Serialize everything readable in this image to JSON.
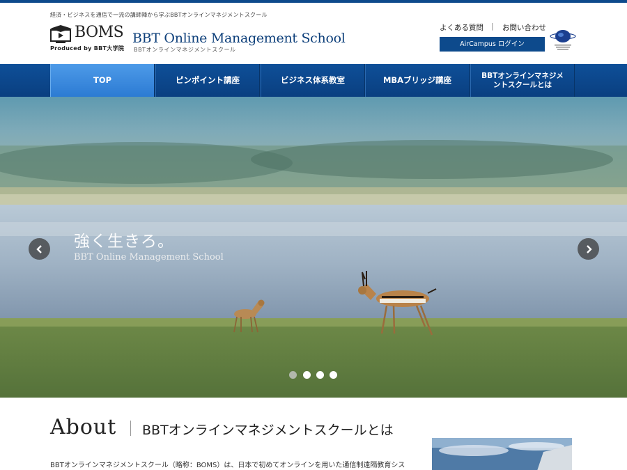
{
  "header": {
    "tagline": "経済・ビジネスを通信で一流の講師陣から学ぶBBTオンラインマネジメントスクール",
    "logo_text": "BOMS",
    "logo_produced": "Produced by BBT大学院",
    "school_name": "BBT Online Management School",
    "school_name_jp": "BBTオンラインマネジメントスクール",
    "faq_label": "よくある質問",
    "separator": "|",
    "contact_label": "お問い合わせ",
    "login_label": "AirCampus ログイン",
    "badge_icon": "globe-badge-icon"
  },
  "nav": {
    "items": [
      {
        "label": "TOP"
      },
      {
        "label": "ピンポイント講座"
      },
      {
        "label": "ビジネス体系教室"
      },
      {
        "label": "MBAブリッジ講座"
      },
      {
        "label": "BBTオンラインマネジメントスクールとは"
      }
    ],
    "active_index": 0
  },
  "hero": {
    "title": "強く生きろ。",
    "subtitle": "BBT Online Management School",
    "prev_icon": "chevron-left-icon",
    "next_icon": "chevron-right-icon",
    "slide_count": 4,
    "active_slide": 1
  },
  "about": {
    "heading_en": "About",
    "heading_jp": "BBTオンラインマネジメントスクールとは",
    "body": "BBTオンラインマネジメントスクール（略称：BOMS）は、日本で初めてオンラインを用いた通信制遠隔教育シス"
  },
  "colors": {
    "brand": "#0d4a8c",
    "nav_active": "#3a8be0"
  }
}
